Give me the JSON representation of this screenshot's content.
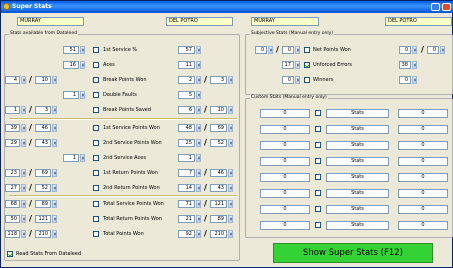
{
  "window": {
    "title": "Super Stats"
  },
  "header": {
    "player1_left": "MURRAY",
    "player2_left": "DEL POTRO",
    "player1_right": "MURRAY",
    "player2_right": "DEL POTRO"
  },
  "dataleed": {
    "group_label": "Stats available from Dataleed",
    "rows": [
      {
        "label": "1st Service %",
        "p1": [
          "51"
        ],
        "p2": [
          "57"
        ]
      },
      {
        "label": "Aces",
        "p1": [
          "16"
        ],
        "p2": [
          "11"
        ]
      },
      {
        "label": "Break Points Won",
        "p1": [
          "4",
          "10"
        ],
        "p2": [
          "2",
          "3"
        ]
      },
      {
        "label": "Double Faults",
        "p1": [
          "1"
        ],
        "p2": [
          "5"
        ]
      },
      {
        "label": "Break Points Saved",
        "p1": [
          "1",
          "3"
        ],
        "p2": [
          "6",
          "10"
        ]
      },
      {
        "label": "1st Service Points Won",
        "p1": [
          "39",
          "46"
        ],
        "p2": [
          "48",
          "69"
        ]
      },
      {
        "label": "2nd Service Points Won",
        "p1": [
          "29",
          "43"
        ],
        "p2": [
          "25",
          "52"
        ]
      },
      {
        "label": "2nd Service Aces",
        "p1": [
          "1"
        ],
        "p2": [
          "1"
        ]
      },
      {
        "label": "1st Return Points Won",
        "p1": [
          "23",
          "69"
        ],
        "p2": [
          "7",
          "46"
        ]
      },
      {
        "label": "2nd Return Points Won",
        "p1": [
          "27",
          "52"
        ],
        "p2": [
          "14",
          "43"
        ]
      },
      {
        "label": "Total Service Points Won",
        "p1": [
          "68",
          "89"
        ],
        "p2": [
          "71",
          "121"
        ]
      },
      {
        "label": "Total Return Points Won",
        "p1": [
          "50",
          "121"
        ],
        "p2": [
          "21",
          "89"
        ]
      },
      {
        "label": "Total Points Won",
        "p1": [
          "118",
          "210"
        ],
        "p2": [
          "92",
          "210"
        ]
      }
    ]
  },
  "read_stats": {
    "label": "Read Stats From Dataleed",
    "checked": true
  },
  "subjective": {
    "group_label": "Subjective Stats (Manual entry only)",
    "rows": [
      {
        "label": "Net Points Won",
        "checked": false,
        "p1": [
          "0",
          "0"
        ],
        "p2": [
          "0",
          "0"
        ]
      },
      {
        "label": "Unforced Errors",
        "checked": true,
        "p1": [
          "17"
        ],
        "p2": [
          "38"
        ]
      },
      {
        "label": "Winners",
        "checked": false,
        "p1": [
          "0"
        ],
        "p2": [
          "0"
        ]
      }
    ]
  },
  "custom": {
    "group_label": "Custom Stats (Manual entry only)",
    "rows": [
      {
        "left": "0",
        "label": "Stats",
        "right": "0"
      },
      {
        "left": "0",
        "label": "Stats",
        "right": "0"
      },
      {
        "left": "0",
        "label": "Stats",
        "right": "0"
      },
      {
        "left": "0",
        "label": "Stats",
        "right": "0"
      },
      {
        "left": "0",
        "label": "Stats",
        "right": "0"
      },
      {
        "left": "0",
        "label": "Stats",
        "right": "0"
      },
      {
        "left": "0",
        "label": "Stats",
        "right": "0"
      },
      {
        "left": "0",
        "label": "Stats",
        "right": "0"
      }
    ]
  },
  "show_button": {
    "label": "Show Super Stats (F12)"
  }
}
